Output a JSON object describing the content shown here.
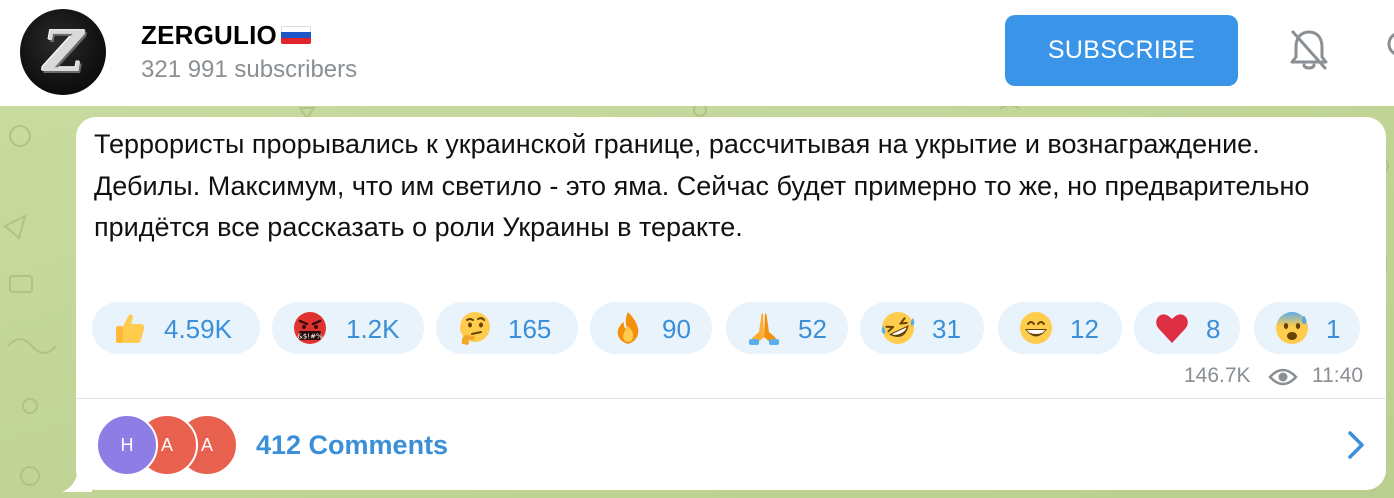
{
  "header": {
    "avatar_letter": "Z",
    "channel_name": "ZERGULIO",
    "flag": "russia-flag",
    "subscribers": "321 991 subscribers",
    "subscribe_label": "SUBSCRIBE",
    "mute_icon": "bell-off-icon",
    "search_icon": "search-icon"
  },
  "message": {
    "text": "Террористы прорывались к украинской границе, рассчитывая на укрытие и вознаграждение. Дебилы. Максимум, что им светило - это яма. Сейчас будет примерно то же, но предварительно придётся все рассказать о роли Украины в теракте.",
    "reactions": [
      {
        "emoji": "thumbs-up",
        "count": "4.59K"
      },
      {
        "emoji": "face-with-symbols-on-mouth",
        "count": "1.2K"
      },
      {
        "emoji": "thinking-face",
        "count": "165"
      },
      {
        "emoji": "fire",
        "count": "90"
      },
      {
        "emoji": "folded-hands",
        "count": "52"
      },
      {
        "emoji": "rolling-on-the-floor-laughing",
        "count": "31"
      },
      {
        "emoji": "grinning-face",
        "count": "12"
      },
      {
        "emoji": "red-heart",
        "count": "8"
      },
      {
        "emoji": "anxious-face-with-sweat",
        "count": "1"
      }
    ],
    "views": "146.7K",
    "time": "11:40"
  },
  "comments": {
    "avatars": [
      {
        "letter": "Н",
        "color": "#8f7de6"
      },
      {
        "letter": "А",
        "color": "#e8604e"
      },
      {
        "letter": "А",
        "color": "#e8604e"
      }
    ],
    "label": "412 Comments"
  },
  "colors": {
    "accent": "#3a95e8",
    "link": "#3a8fd8",
    "reaction_bg": "#e9f3fb",
    "chat_bg": "#c7d8a0"
  }
}
